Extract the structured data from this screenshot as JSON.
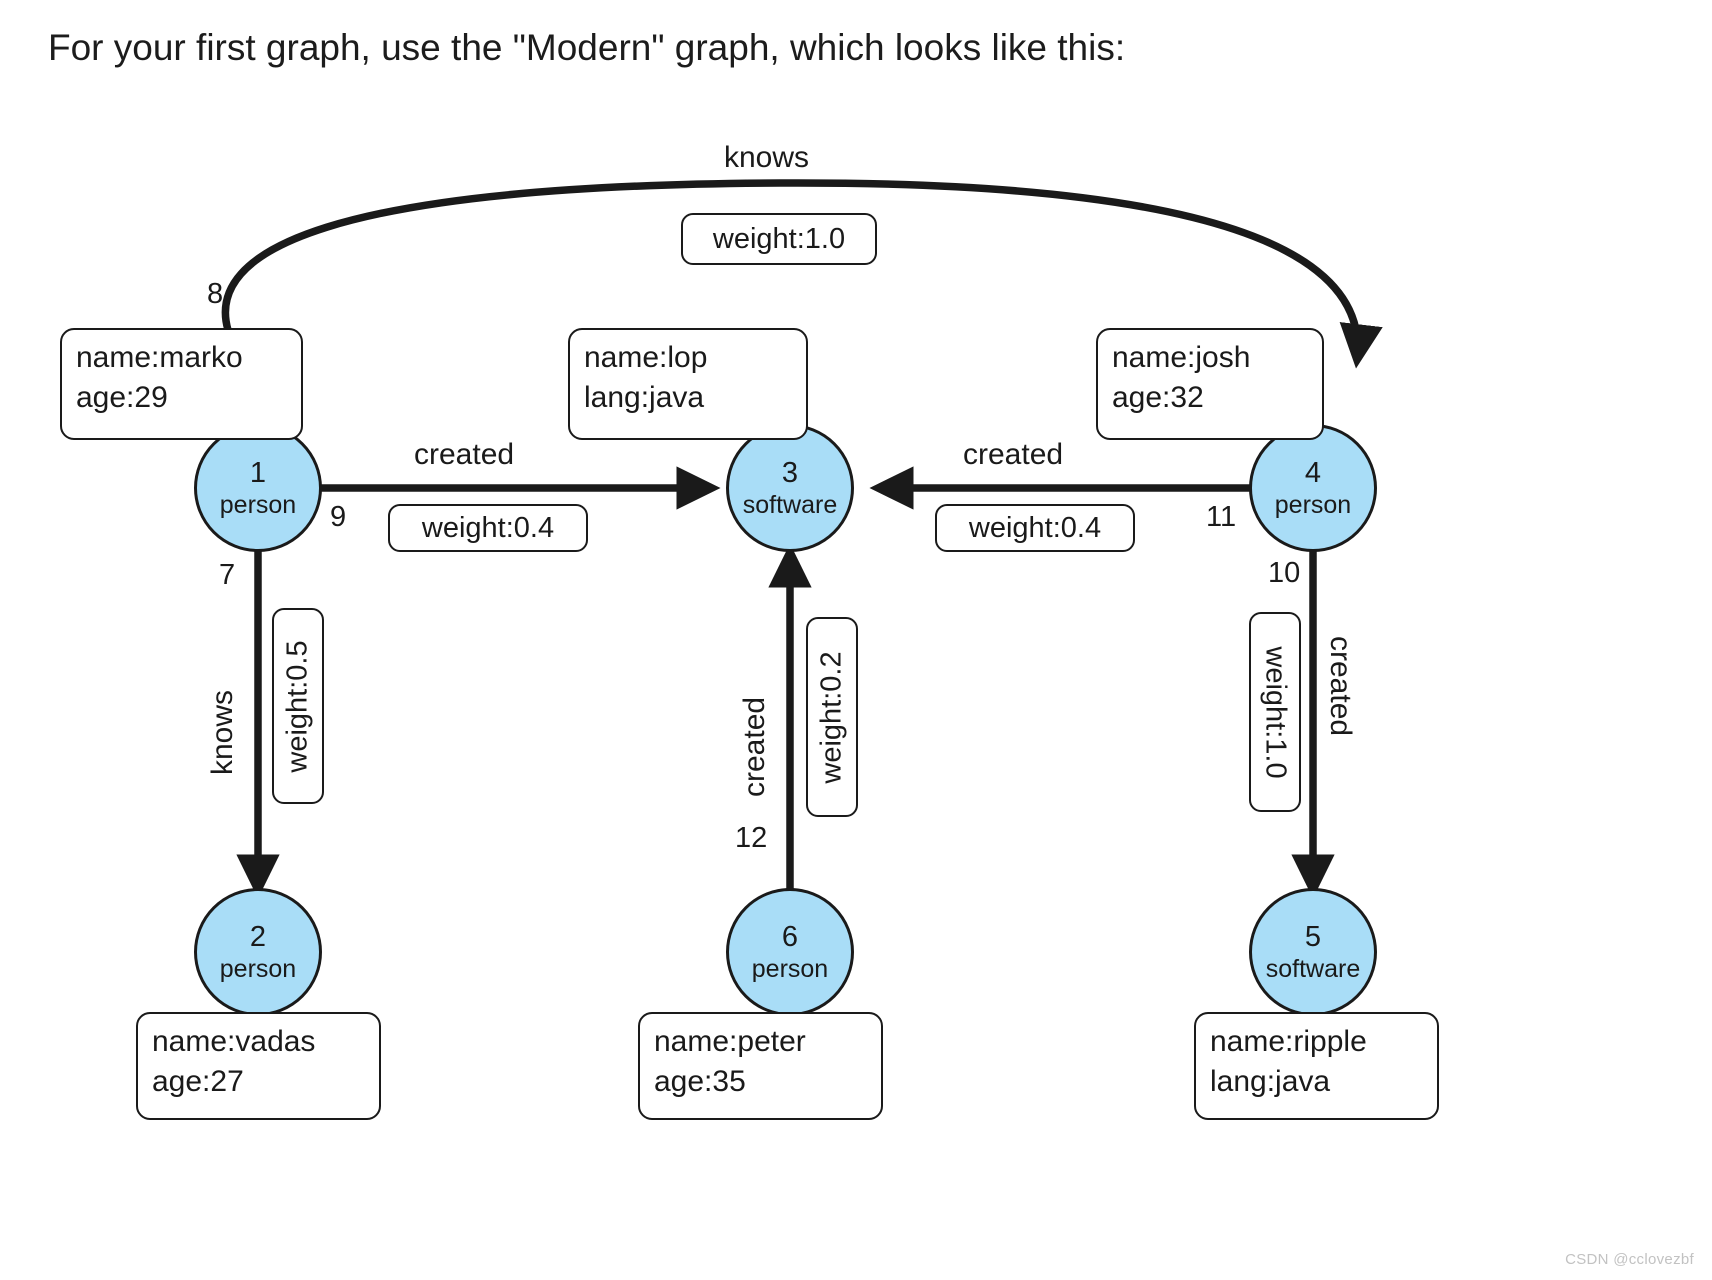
{
  "caption": "For your first graph, use the \"Modern\" graph, which looks like this:",
  "watermark": "CSDN @cclovezbf",
  "colors": {
    "vertex_fill": "#a9ddf7",
    "stroke": "#1a1a1a",
    "background": "#ffffff"
  },
  "graph": {
    "name": "Modern",
    "vertices": [
      {
        "id": "1",
        "label": "person",
        "props": [
          "name:marko",
          "age:29"
        ]
      },
      {
        "id": "2",
        "label": "person",
        "props": [
          "name:vadas",
          "age:27"
        ]
      },
      {
        "id": "3",
        "label": "software",
        "props": [
          "name:lop",
          "lang:java"
        ]
      },
      {
        "id": "4",
        "label": "person",
        "props": [
          "name:josh",
          "age:32"
        ]
      },
      {
        "id": "5",
        "label": "software",
        "props": [
          "name:ripple",
          "lang:java"
        ]
      },
      {
        "id": "6",
        "label": "person",
        "props": [
          "name:peter",
          "age:35"
        ]
      }
    ],
    "edges": [
      {
        "id": "7",
        "label": "knows",
        "weight": "weight:0.5",
        "from": "1",
        "to": "2"
      },
      {
        "id": "8",
        "label": "knows",
        "weight": "weight:1.0",
        "from": "1",
        "to": "4"
      },
      {
        "id": "9",
        "label": "created",
        "weight": "weight:0.4",
        "from": "1",
        "to": "3"
      },
      {
        "id": "10",
        "label": "created",
        "weight": "weight:1.0",
        "from": "4",
        "to": "5"
      },
      {
        "id": "11",
        "label": "created",
        "weight": "weight:0.4",
        "from": "4",
        "to": "3"
      },
      {
        "id": "12",
        "label": "created",
        "weight": "weight:0.2",
        "from": "6",
        "to": "3"
      }
    ]
  },
  "chart_data": {
    "type": "diagram",
    "title": "Modern graph",
    "nodes": [
      {
        "id": "1",
        "type": "person",
        "name": "marko",
        "age": 29
      },
      {
        "id": "2",
        "type": "person",
        "name": "vadas",
        "age": 27
      },
      {
        "id": "3",
        "type": "software",
        "name": "lop",
        "lang": "java"
      },
      {
        "id": "4",
        "type": "person",
        "name": "josh",
        "age": 32
      },
      {
        "id": "5",
        "type": "software",
        "name": "ripple",
        "lang": "java"
      },
      {
        "id": "6",
        "type": "person",
        "name": "peter",
        "age": 35
      }
    ],
    "links": [
      {
        "id": "7",
        "source": "1",
        "target": "2",
        "label": "knows",
        "weight": 0.5
      },
      {
        "id": "8",
        "source": "1",
        "target": "4",
        "label": "knows",
        "weight": 1.0
      },
      {
        "id": "9",
        "source": "1",
        "target": "3",
        "label": "created",
        "weight": 0.4
      },
      {
        "id": "10",
        "source": "4",
        "target": "5",
        "label": "created",
        "weight": 1.0
      },
      {
        "id": "11",
        "source": "4",
        "target": "3",
        "label": "created",
        "weight": 0.4
      },
      {
        "id": "12",
        "source": "6",
        "target": "3",
        "label": "created",
        "weight": 0.2
      }
    ]
  },
  "labels": {
    "knows_top": "knows",
    "weight_top": "weight:1.0",
    "edge8_num": "8",
    "created_left": "created",
    "weight_left": "weight:0.4",
    "edge9_num": "9",
    "created_right": "created",
    "weight_right": "weight:0.4",
    "edge11_num": "11",
    "knows_down": "knows",
    "weight_down_left": "weight:0.5",
    "edge7_num": "7",
    "created_mid": "created",
    "weight_mid": "weight:0.2",
    "edge12_num": "12",
    "created_far_right": "created",
    "weight_far_right": "weight:1.0",
    "edge10_num": "10"
  }
}
